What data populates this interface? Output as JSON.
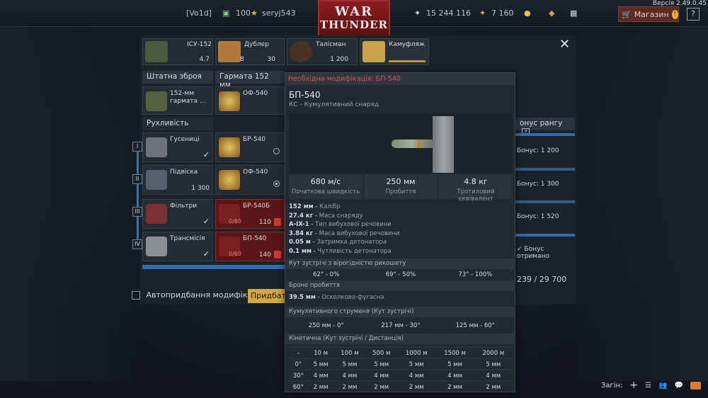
{
  "version": "Версія 2.49.0.45",
  "topbar": {
    "clan": "[Vo1d]",
    "rank": "100",
    "username": "seryj543",
    "silver": "15 244 116",
    "gold": "7 160",
    "logo_line1": "WAR",
    "logo_line2": "THUNDER",
    "shop": "Магазин",
    "help": "?"
  },
  "vehicle_cards": [
    {
      "title": "ІСУ-152",
      "value": "4.7"
    },
    {
      "title": "Дублер",
      "left": "8",
      "value": "30"
    },
    {
      "title": "Талісман",
      "value": "1 200"
    },
    {
      "title": "Камуфляж",
      "value": ""
    }
  ],
  "sections": {
    "weapon": "Штатна зброя",
    "gun": "Гармата 152 мм",
    "mobility": "Рухливість",
    "rank_bonus": "онус рангу"
  },
  "weapon_cell": {
    "name": "152-мм гармата ..."
  },
  "ammo_cells": [
    {
      "name": "ОФ-540"
    },
    {
      "name": "БР-540"
    },
    {
      "name": "ОФ-540"
    },
    {
      "name": "БР-540Б",
      "progress": "0/60",
      "cost": "110"
    },
    {
      "name": "БП-540",
      "progress": "0/60",
      "cost": "140"
    }
  ],
  "mobility_cells": [
    {
      "name": "Гусениці",
      "value": ""
    },
    {
      "name": "Підвіска",
      "value": "1 300"
    },
    {
      "name": "Фільтри",
      "value": ""
    },
    {
      "name": "Трансмісія",
      "value": ""
    }
  ],
  "ranks": [
    "I",
    "II",
    "III",
    "IV"
  ],
  "right_bonuses": [
    "Бонус: 1 200",
    "Бонус: 1 300",
    "Бонус: 1 520",
    "Бонус отримано"
  ],
  "right_total": "239 / 29 700",
  "autobuy_label": "Автопридбання модифікацій",
  "buy_button": "Придбати",
  "tooltip": {
    "required": "Необхідна модифікація: БП-540",
    "name": "БП-540",
    "type": "КС - Кумулятивний снаряд",
    "stats": [
      {
        "value": "680 м/с",
        "label": "Початкова швидкість"
      },
      {
        "value": "250 мм",
        "label": "Пробиття"
      },
      {
        "value": "4.8 кг",
        "label": "Тротиловий еквівалент"
      }
    ],
    "specs": [
      {
        "v": "152 мм",
        "k": "Калібр"
      },
      {
        "v": "27.4 кг",
        "k": "Маса снаряду"
      },
      {
        "v": "A-IX-1",
        "k": "Тип вибухової речовини"
      },
      {
        "v": "3.84 кг",
        "k": "Маса вибухової речовини"
      },
      {
        "v": "0.05 м",
        "k": "Затримка детонатора"
      },
      {
        "v": "0.1 мм",
        "k": "Чутливість детонатора"
      }
    ],
    "ricochet_header": "Кут зустрічі з вірогідністю рикошету",
    "ricochet": [
      "62° - 0%",
      "69° - 50%",
      "73° - 100%"
    ],
    "armor_header": "Броне пробиття",
    "he_pen": {
      "v": "39.5 мм",
      "k": "Осколково-фугасна"
    },
    "cumulative_header": "Кумулятивного струменя (Кут зустрічі)",
    "cumulative": [
      "250 мм - 0°",
      "217 мм - 30°",
      "125 мм - 60°"
    ],
    "kinetic_header": "Кінетична (Кут зустрічі / Дистанція)",
    "kinetic_cols": [
      "-",
      "10 м",
      "100 м",
      "500 м",
      "1000 м",
      "1500 м",
      "2000 м"
    ],
    "kinetic_rows": [
      [
        "0°",
        "5 мм",
        "5 мм",
        "5 мм",
        "5 мм",
        "5 мм",
        "5 мм"
      ],
      [
        "30°",
        "4 мм",
        "4 мм",
        "4 мм",
        "4 мм",
        "4 мм",
        "4 мм"
      ],
      [
        "60°",
        "2 мм",
        "2 мм",
        "2 мм",
        "2 мм",
        "2 мм",
        "2 мм"
      ]
    ]
  },
  "bottom": {
    "zoom": "Загін:"
  }
}
